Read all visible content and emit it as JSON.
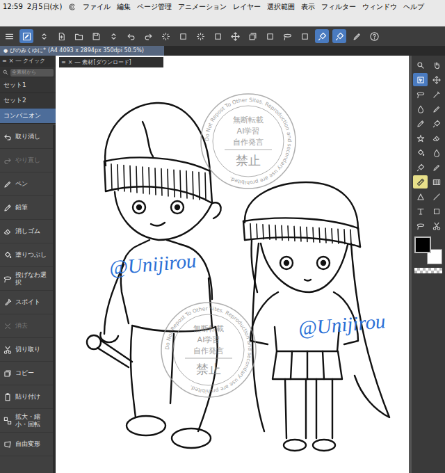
{
  "status_bar": {
    "time": "12:59",
    "date": "2月5日(水)"
  },
  "menu": [
    "ファイル",
    "編集",
    "ページ管理",
    "アニメーション",
    "レイヤー",
    "選択範囲",
    "表示",
    "フィルター",
    "ウィンドウ",
    "ヘルプ"
  ],
  "toolbar": [
    {
      "selected": false
    },
    {
      "selected": true
    },
    {
      "selected": false
    },
    {
      "selected": false
    },
    {
      "selected": false
    },
    {
      "selected": false
    },
    {
      "selected": false
    },
    {
      "selected": false
    },
    {
      "selected": false
    },
    {
      "selected": false
    },
    {
      "selected": false
    },
    {
      "selected": false
    },
    {
      "selected": false
    },
    {
      "selected": false
    },
    {
      "selected": false
    },
    {
      "selected": false
    },
    {
      "selected": false
    },
    {
      "selected": false
    },
    {
      "selected": true
    },
    {
      "selected": true
    },
    {
      "selected": false
    },
    {
      "selected": false
    }
  ],
  "document_tab": {
    "dot": "●",
    "title": "ぴのみくゆに*",
    "info": "(A4 4093 x 2894px 350dpi 50.5%)",
    "selected": true
  },
  "quick_panel": {
    "menu": "≡",
    "close": "×",
    "minimize": "―",
    "title": "クイック"
  },
  "material_panel": {
    "menu": "≡",
    "close": "×",
    "minimize": "―",
    "title": "素材[ダウンロード]"
  },
  "search": {
    "placeholder": "全素材から"
  },
  "sets": [
    {
      "label": "セット1",
      "selected": false
    },
    {
      "label": "セット2",
      "selected": false
    },
    {
      "label": "コンパニオン",
      "selected": true
    }
  ],
  "commands": [
    {
      "label": "取り消し",
      "disabled": false
    },
    {
      "label": "やり直し",
      "disabled": true
    },
    {
      "label": "ペン",
      "disabled": false
    },
    {
      "label": "鉛筆",
      "disabled": false
    },
    {
      "label": "消しゴム",
      "disabled": false
    },
    {
      "label": "塗りつぶし",
      "disabled": false
    },
    {
      "label": "投げなわ選択",
      "disabled": false
    },
    {
      "label": "スポイト",
      "disabled": false
    },
    {
      "label": "消去",
      "disabled": true
    },
    {
      "label": "切り取り",
      "disabled": false
    },
    {
      "label": "コピー",
      "disabled": false
    },
    {
      "label": "貼り付け",
      "disabled": false
    },
    {
      "label": "拡大・縮小・回転",
      "disabled": false
    },
    {
      "label": "自由変形",
      "disabled": false
    }
  ],
  "canvas": {
    "watermarks": [
      {
        "ring": "Do Not Repost To Other Sites. Reproduction and secondary use are prohibited.",
        "lines": [
          "無断転載",
          "AI学習",
          "自作発言"
        ],
        "stamp": "禁止"
      },
      {
        "ring": "Do Not Repost To Other Sites. Reproduction and secondary use are prohibited.",
        "lines": [
          "無断転載",
          "AI学習",
          "自作発言"
        ],
        "stamp": "禁止"
      }
    ],
    "signatures": [
      "@Unijirou",
      "@Unijirou"
    ]
  },
  "tools": [
    {
      "selected": false
    },
    {
      "selected": false
    },
    {
      "selected": true
    },
    {
      "selected": false
    },
    {
      "selected": false
    },
    {
      "selected": false
    },
    {
      "selected": false
    },
    {
      "selected": false
    },
    {
      "selected": false
    },
    {
      "selected": false
    },
    {
      "selected": false
    },
    {
      "selected": false
    },
    {
      "selected": false
    },
    {
      "selected": false
    },
    {
      "selected": false
    },
    {
      "selected": false
    },
    {
      "selected": false
    },
    {
      "selected": false
    },
    {
      "selected": false
    },
    {
      "selected": false
    },
    {
      "selected": false
    },
    {
      "selected": false
    },
    {
      "selected": false
    },
    {
      "selected": false
    }
  ],
  "color_swatches": {
    "main": {
      "color": "#000000"
    },
    "sub": {
      "color": "#ffffff"
    }
  }
}
